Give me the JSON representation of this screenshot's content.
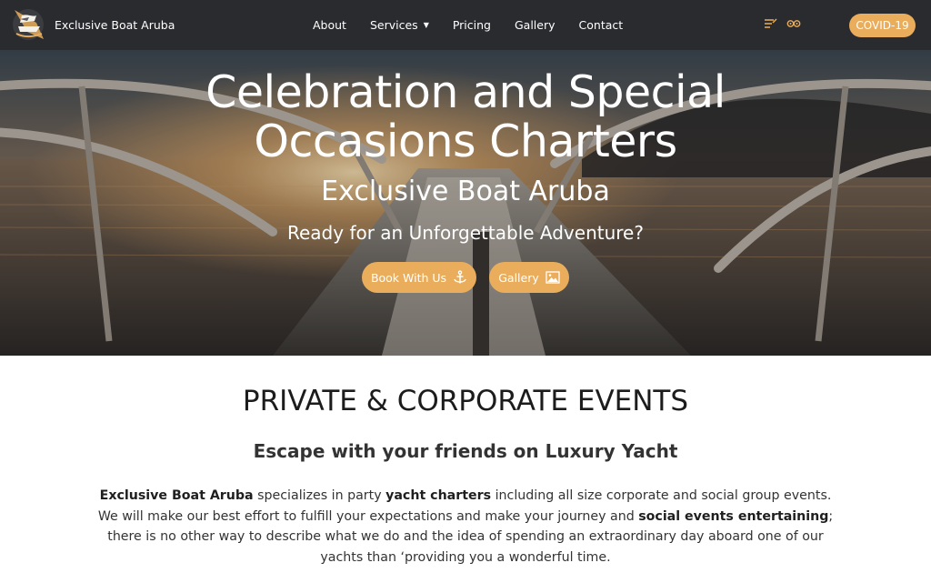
{
  "header": {
    "brand_name": "Exclusive Boat Aruba",
    "nav": [
      {
        "label": "About"
      },
      {
        "label": "Services",
        "has_dropdown": true
      },
      {
        "label": "Pricing"
      },
      {
        "label": "Gallery"
      },
      {
        "label": "Contact"
      }
    ],
    "social_icons": [
      "tripadvisor-icon",
      "tripadvisor-owl-icon"
    ],
    "covid_button": "COVID-19"
  },
  "hero": {
    "title_line1": "Celebration and Special",
    "title_line2": "Occasions Charters",
    "subtitle": "Exclusive Boat Aruba",
    "tagline": "Ready for an Unforgettable Adventure?",
    "book_button": "Book With Us",
    "book_icon": "anchor-icon",
    "gallery_button": "Gallery",
    "gallery_icon": "image-icon"
  },
  "section": {
    "title": "PRIVATE & CORPORATE EVENTS",
    "subtitle": "Escape with your friends on Luxury Yacht",
    "body": {
      "brand": "Exclusive Boat Aruba",
      "t1": " specializes in party ",
      "b1": "yacht charters",
      "t2": " including all size corporate and social group events. We will make our best effort to fulfill your expectations and make your journey and ",
      "b2": "social events entertaining",
      "t3": "; there is no other way to describe what we do and the idea of spending an extraordinary day aboard one of our yachts than ‘providing you a wonderful time."
    }
  },
  "colors": {
    "accent": "#e9ad5c",
    "header_bg": "#2a2b2f",
    "text": "#333333"
  }
}
